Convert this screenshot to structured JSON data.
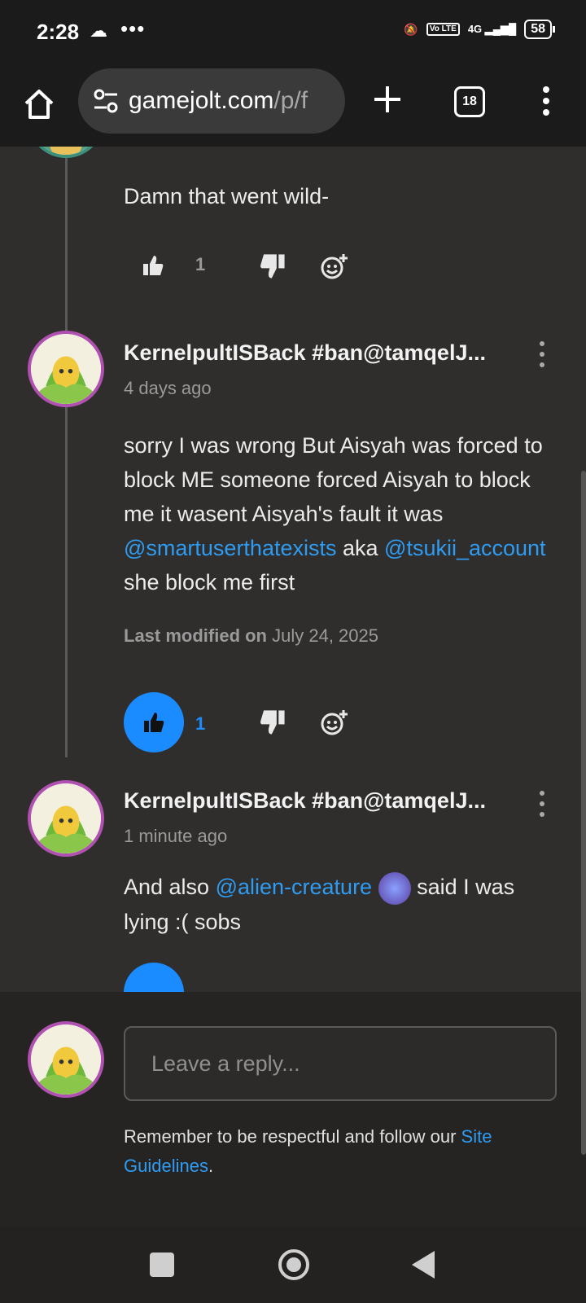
{
  "status": {
    "time": "2:28",
    "cloud_icon": "cloud-icon",
    "more_notifications": "•••",
    "volte": "Vo LTE",
    "network": "4G",
    "battery": "58"
  },
  "browser": {
    "url_host": "gamejolt.com",
    "url_path": "/p/f",
    "tab_count": "18"
  },
  "comments": [
    {
      "text": "Damn that went wild-",
      "likes": "1"
    },
    {
      "username": "KernelpultISBack #ban@tamqelJ...",
      "time": "4 days ago",
      "text_parts": {
        "a": "sorry I was wrong But Aisyah was forced to block ME someone forced Aisyah to block me it wasent Aisyah's fault it was ",
        "m1": "@smartuserthatexists",
        "b": " aka ",
        "m2": "@tsukii_account",
        "c": " she block me first"
      },
      "modified_label": "Last modified on",
      "modified_date": "July 24, 2025",
      "likes": "1"
    },
    {
      "username": "KernelpultISBack #ban@tamqelJ...",
      "time": "1 minute ago",
      "text_parts": {
        "a": "And also ",
        "m1": "@alien-creature",
        "b": " said I was lying :( sobs"
      }
    }
  ],
  "reply": {
    "placeholder": "Leave a reply...",
    "reminder": "Remember to be respectful and follow our ",
    "guidelines_link": "Site Guidelines",
    "period": "."
  },
  "colors": {
    "accent": "#1a8cff",
    "mention": "#2f9cf3",
    "background": "#2f2e2c"
  }
}
